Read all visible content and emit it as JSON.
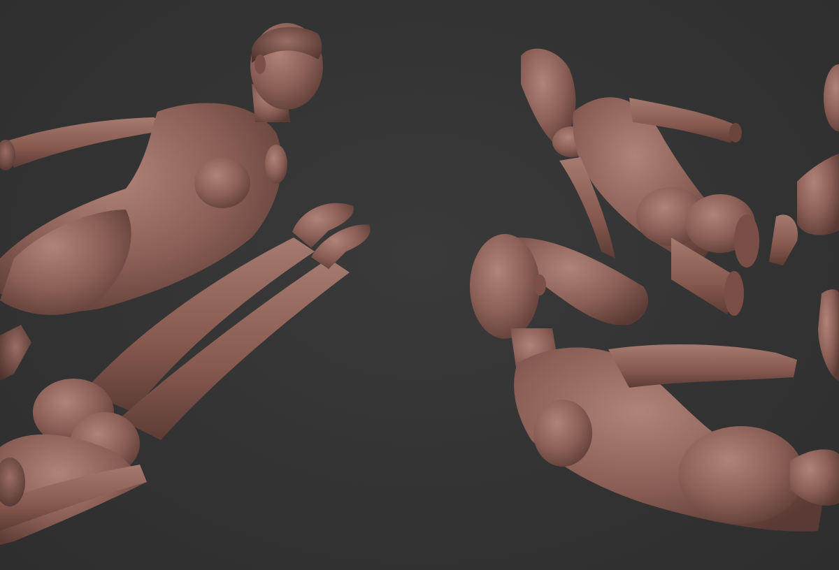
{
  "scene": {
    "background_color": "#333333",
    "material_color": "#8a5f56",
    "material_shadow_color": "#5a3a34",
    "material_highlight_color": "#b08378",
    "subjects": [
      {
        "name": "clay-figure-left-upper"
      },
      {
        "name": "clay-figure-left-lower"
      },
      {
        "name": "clay-figure-right-torso-back"
      },
      {
        "name": "clay-figure-right-lower"
      },
      {
        "name": "clay-figure-right-edge"
      }
    ]
  }
}
